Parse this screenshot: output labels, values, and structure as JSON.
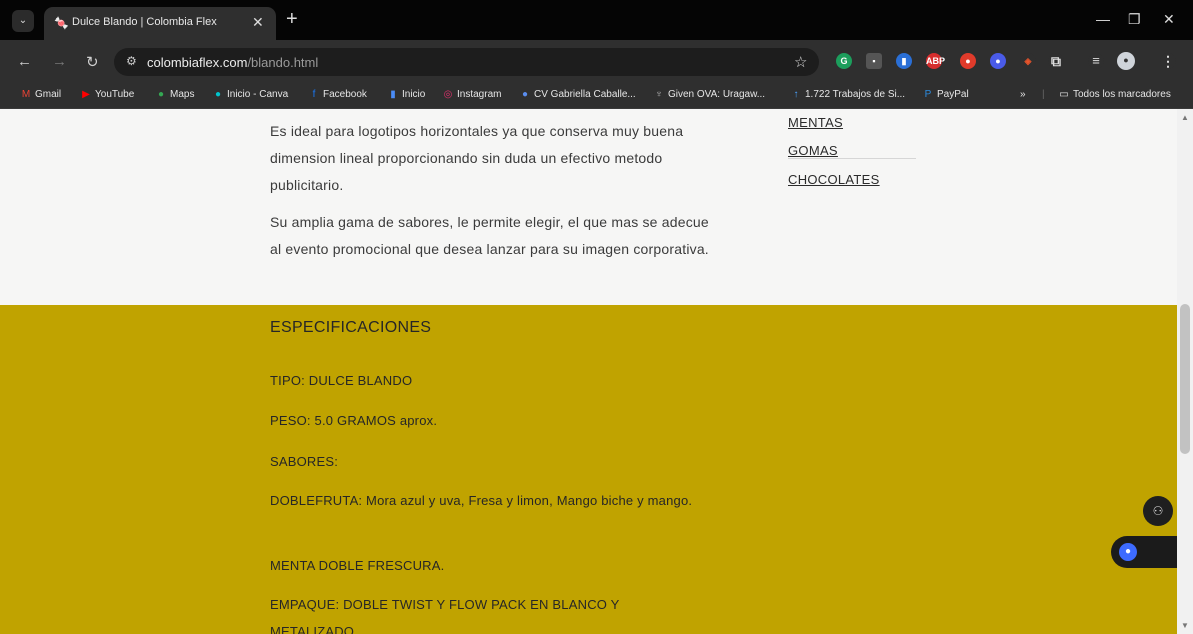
{
  "browser": {
    "tab_title": "Dulce Blando | Colombia Flex",
    "url_host": "colombiaflex.com",
    "url_path": "/blando.html",
    "bookmarks": [
      "Gmail",
      "YouTube",
      "Maps",
      "Inicio - Canva",
      "Facebook",
      "Inicio",
      "Instagram",
      "CV Gabriella Caballe...",
      "Given OVA: Uragaw...",
      "1.722 Trabajos de Si...",
      "PayPal",
      "Todos los marcadores"
    ]
  },
  "content": {
    "para1": "Es ideal para logotipos horizontales ya que conserva muy buena dimension lineal proporcionando sin duda un efectivo metodo publicitario.",
    "para2": "Su amplia gama de sabores, le permite elegir, el que mas se adecue al evento promocional que desea lanzar para su imagen corporativa."
  },
  "sidebar": {
    "links": [
      "MENTAS",
      "GOMAS",
      "CHOCOLATES"
    ]
  },
  "specs": {
    "title": "ESPECIFICACIONES",
    "tipo": "TIPO: DULCE BLANDO",
    "peso": "PESO: 5.0 GRAMOS aprox.",
    "sabores": "SABORES:",
    "doblefruta": "DOBLEFRUTA: Mora azul y uva, Fresa y limon, Mango biche y mango.",
    "menta": "MENTA DOBLE FRESCURA.",
    "empaque": "EMPAQUE: DOBLE TWIST Y FLOW PACK EN BLANCO Y METALIZADO"
  },
  "colors": {
    "accent": "#c0a300",
    "background": "#f6f6f5"
  }
}
